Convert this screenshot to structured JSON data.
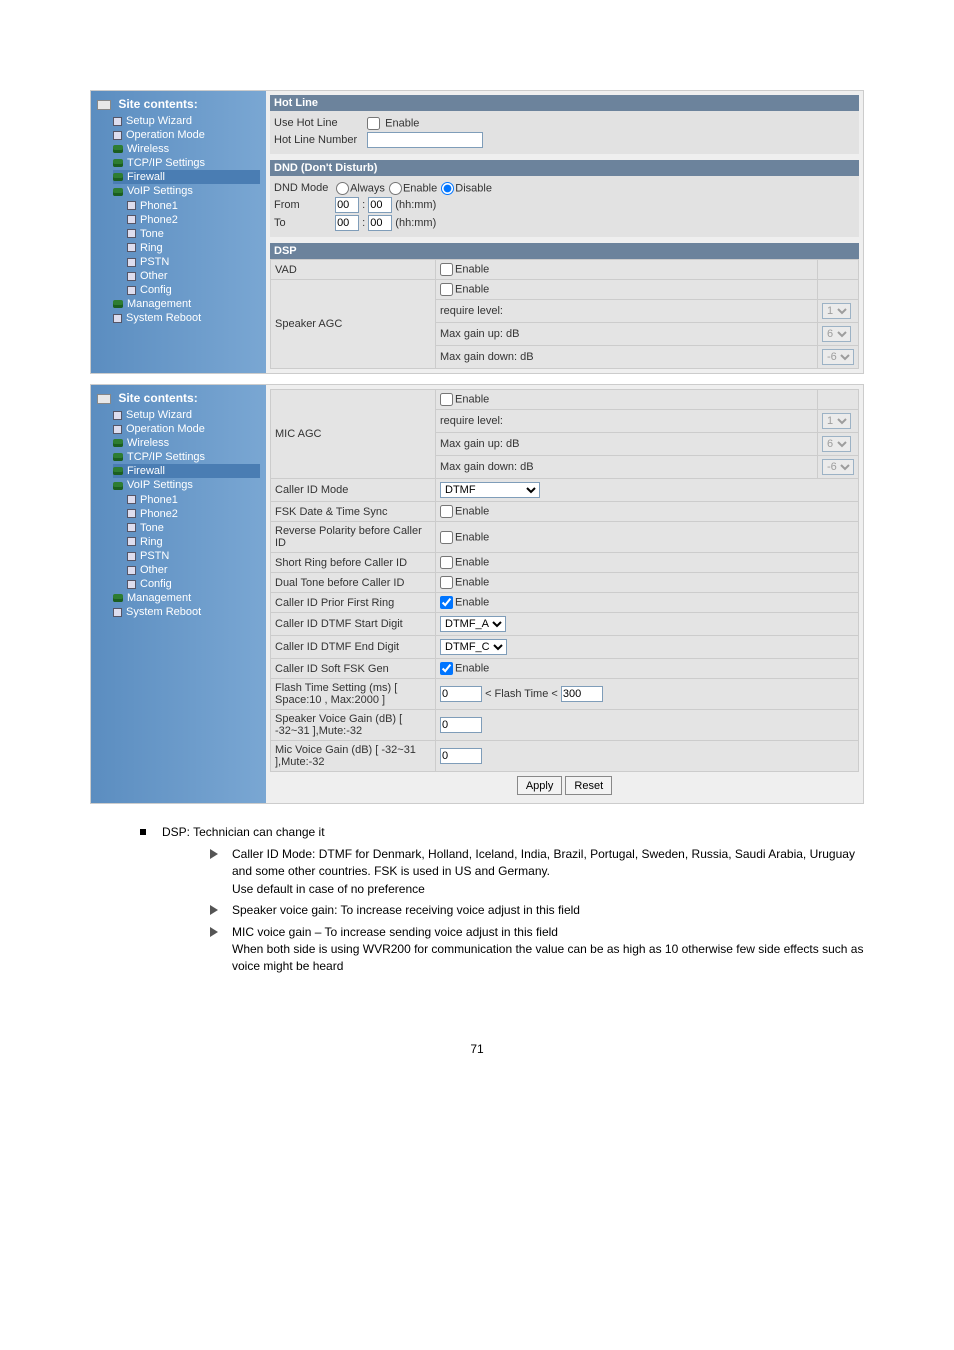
{
  "sidebar": {
    "title": "Site contents:",
    "items": [
      {
        "label": "Setup Wizard",
        "icon": "sq",
        "lvl": 1
      },
      {
        "label": "Operation Mode",
        "icon": "sq",
        "lvl": 1
      },
      {
        "label": "Wireless",
        "icon": "folder",
        "lvl": 1
      },
      {
        "label": "TCP/IP Settings",
        "icon": "folder",
        "lvl": 1
      },
      {
        "label": "Firewall",
        "icon": "folder",
        "lvl": 1,
        "active": true
      },
      {
        "label": "VoIP Settings",
        "icon": "folder",
        "lvl": 1
      },
      {
        "label": "Phone1",
        "icon": "sq",
        "lvl": 2
      },
      {
        "label": "Phone2",
        "icon": "sq",
        "lvl": 2
      },
      {
        "label": "Tone",
        "icon": "sq",
        "lvl": 2
      },
      {
        "label": "Ring",
        "icon": "sq",
        "lvl": 2
      },
      {
        "label": "PSTN",
        "icon": "sq",
        "lvl": 2
      },
      {
        "label": "Other",
        "icon": "sq",
        "lvl": 2
      },
      {
        "label": "Config",
        "icon": "sq",
        "lvl": 2
      },
      {
        "label": "Management",
        "icon": "folder",
        "lvl": 1
      },
      {
        "label": "System Reboot",
        "icon": "sq",
        "lvl": 1
      }
    ]
  },
  "panel1": {
    "hotline": {
      "header": "Hot Line",
      "use_label": "Use Hot Line",
      "enable_label": "Enable",
      "number_label": "Hot Line Number",
      "number_value": ""
    },
    "dnd": {
      "header": "DND (Don't Disturb)",
      "mode_label": "DND Mode",
      "opt_always": "Always",
      "opt_enable": "Enable",
      "opt_disable": "Disable",
      "from_label": "From",
      "to_label": "To",
      "hh": "00",
      "mm": "00",
      "hhmm": "(hh:mm)"
    },
    "dsp": {
      "header": "DSP",
      "vad_label": "VAD",
      "spk_agc_label": "Speaker AGC",
      "enable": "Enable",
      "req_level": "require level:",
      "req_val": "1",
      "max_up": "Max gain up: dB",
      "max_up_val": "6",
      "max_down": "Max gain down: dB",
      "max_down_val": "-6"
    }
  },
  "panel2": {
    "mic_agc_label": "MIC AGC",
    "enable": "Enable",
    "req_level": "require level:",
    "req_val": "1",
    "max_up": "Max gain up: dB",
    "max_up_val": "6",
    "max_down": "Max gain down: dB",
    "max_down_val": "-6",
    "cid_mode": "Caller ID Mode",
    "cid_mode_val": "DTMF",
    "fsk_dt": "FSK Date & Time Sync",
    "rev_pol": "Reverse Polarity before Caller ID",
    "short_ring": "Short Ring before Caller ID",
    "dual_tone": "Dual Tone before Caller ID",
    "cid_prior": "Caller ID Prior First Ring",
    "cid_start": "Caller ID DTMF Start Digit",
    "cid_start_val": "DTMF_A",
    "cid_end": "Caller ID DTMF End Digit",
    "cid_end_val": "DTMF_C",
    "cid_soft": "Caller ID Soft FSK Gen",
    "flash_label": "Flash Time Setting (ms) [ Space:10 , Max:2000 ]",
    "flash_lo": "0",
    "flash_mid": "< Flash Time <",
    "flash_hi": "300",
    "spk_gain": "Speaker Voice Gain (dB) [ -32~31 ],Mute:-32",
    "spk_gain_val": "0",
    "mic_gain": "Mic Voice Gain (dB) [ -32~31 ],Mute:-32",
    "mic_gain_val": "0",
    "apply": "Apply",
    "reset": "Reset"
  },
  "notes": {
    "h": "DSP: Technician can change it",
    "n1": "Caller ID Mode: DTMF for Denmark, Holland, Iceland, India, Brazil, Portugal, Sweden, Russia, Saudi Arabia, Uruguay and some other countries. FSK is used in US and Germany.",
    "n1b": "Use default in case of no preference",
    "n2": "Speaker voice gain: To increase receiving voice adjust in this field",
    "n3a": "MIC voice gain – To increase sending voice adjust in this field",
    "n3b": "When both side is using WVR200 for communication the value can be as high as 10 otherwise few side effects such as voice might be heard"
  },
  "page": "71"
}
